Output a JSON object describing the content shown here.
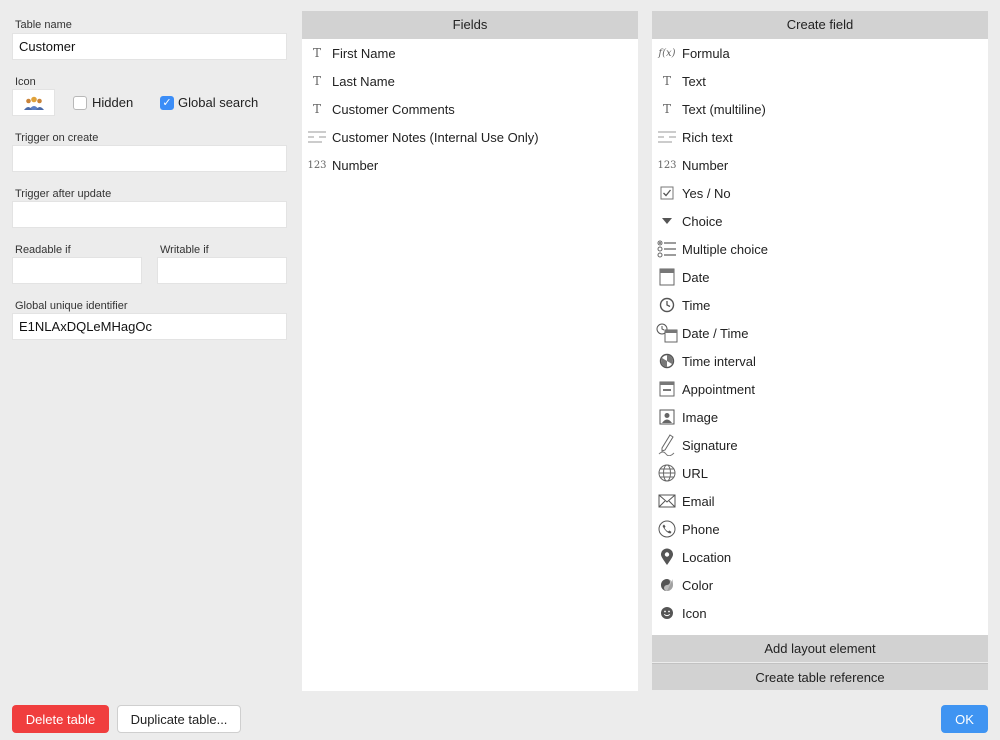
{
  "form": {
    "table_name_label": "Table name",
    "table_name_value": "Customer",
    "icon_label": "Icon",
    "hidden_label": "Hidden",
    "hidden_checked": false,
    "global_search_label": "Global search",
    "global_search_checked": true,
    "trigger_on_create_label": "Trigger on create",
    "trigger_on_create_value": "",
    "trigger_after_update_label": "Trigger after update",
    "trigger_after_update_value": "",
    "readable_if_label": "Readable if",
    "readable_if_value": "",
    "writable_if_label": "Writable if",
    "writable_if_value": "",
    "guid_label": "Global unique identifier",
    "guid_value": "E1NLAxDQLeMHagOc"
  },
  "fields_panel": {
    "header": "Fields",
    "items": [
      {
        "label": "First Name",
        "icon": "text-type-icon",
        "glyph": "T"
      },
      {
        "label": "Last Name",
        "icon": "text-type-icon",
        "glyph": "T"
      },
      {
        "label": "Customer Comments",
        "icon": "text-type-icon",
        "glyph": "T"
      },
      {
        "label": "Customer Notes (Internal Use Only)",
        "icon": "rich-text-icon",
        "glyph": ""
      },
      {
        "label": "Number",
        "icon": "number-type-icon",
        "glyph": "123"
      }
    ]
  },
  "create_panel": {
    "header": "Create field",
    "items": [
      {
        "label": "Formula",
        "icon": "formula-icon",
        "glyph": "f(x)"
      },
      {
        "label": "Text",
        "icon": "text-type-icon",
        "glyph": "T"
      },
      {
        "label": "Text (multiline)",
        "icon": "text-type-icon",
        "glyph": "T"
      },
      {
        "label": "Rich text",
        "icon": "rich-text-icon",
        "glyph": ""
      },
      {
        "label": "Number",
        "icon": "number-type-icon",
        "glyph": "123"
      },
      {
        "label": "Yes / No",
        "icon": "checkbox-icon",
        "glyph": ""
      },
      {
        "label": "Choice",
        "icon": "triangle-down-icon",
        "glyph": ""
      },
      {
        "label": "Multiple choice",
        "icon": "multiple-choice-icon",
        "glyph": ""
      },
      {
        "label": "Date",
        "icon": "calendar-icon",
        "glyph": "5"
      },
      {
        "label": "Time",
        "icon": "clock-icon",
        "glyph": ""
      },
      {
        "label": "Date / Time",
        "icon": "date-time-icon",
        "glyph": "5"
      },
      {
        "label": "Time interval",
        "icon": "time-interval-icon",
        "glyph": ""
      },
      {
        "label": "Appointment",
        "icon": "appointment-icon",
        "glyph": ""
      },
      {
        "label": "Image",
        "icon": "image-icon",
        "glyph": ""
      },
      {
        "label": "Signature",
        "icon": "signature-icon",
        "glyph": ""
      },
      {
        "label": "URL",
        "icon": "globe-icon",
        "glyph": ""
      },
      {
        "label": "Email",
        "icon": "envelope-icon",
        "glyph": ""
      },
      {
        "label": "Phone",
        "icon": "phone-icon",
        "glyph": ""
      },
      {
        "label": "Location",
        "icon": "location-pin-icon",
        "glyph": ""
      },
      {
        "label": "Color",
        "icon": "color-icon",
        "glyph": ""
      },
      {
        "label": "Icon",
        "icon": "smiley-icon",
        "glyph": ""
      }
    ],
    "add_layout_label": "Add layout element",
    "create_reference_label": "Create table reference"
  },
  "buttons": {
    "delete": "Delete table",
    "duplicate": "Duplicate table...",
    "ok": "OK"
  },
  "colors": {
    "accent_blue": "#3f94f2",
    "danger_red": "#f03e3e",
    "header_gray": "#d2d2d2"
  }
}
